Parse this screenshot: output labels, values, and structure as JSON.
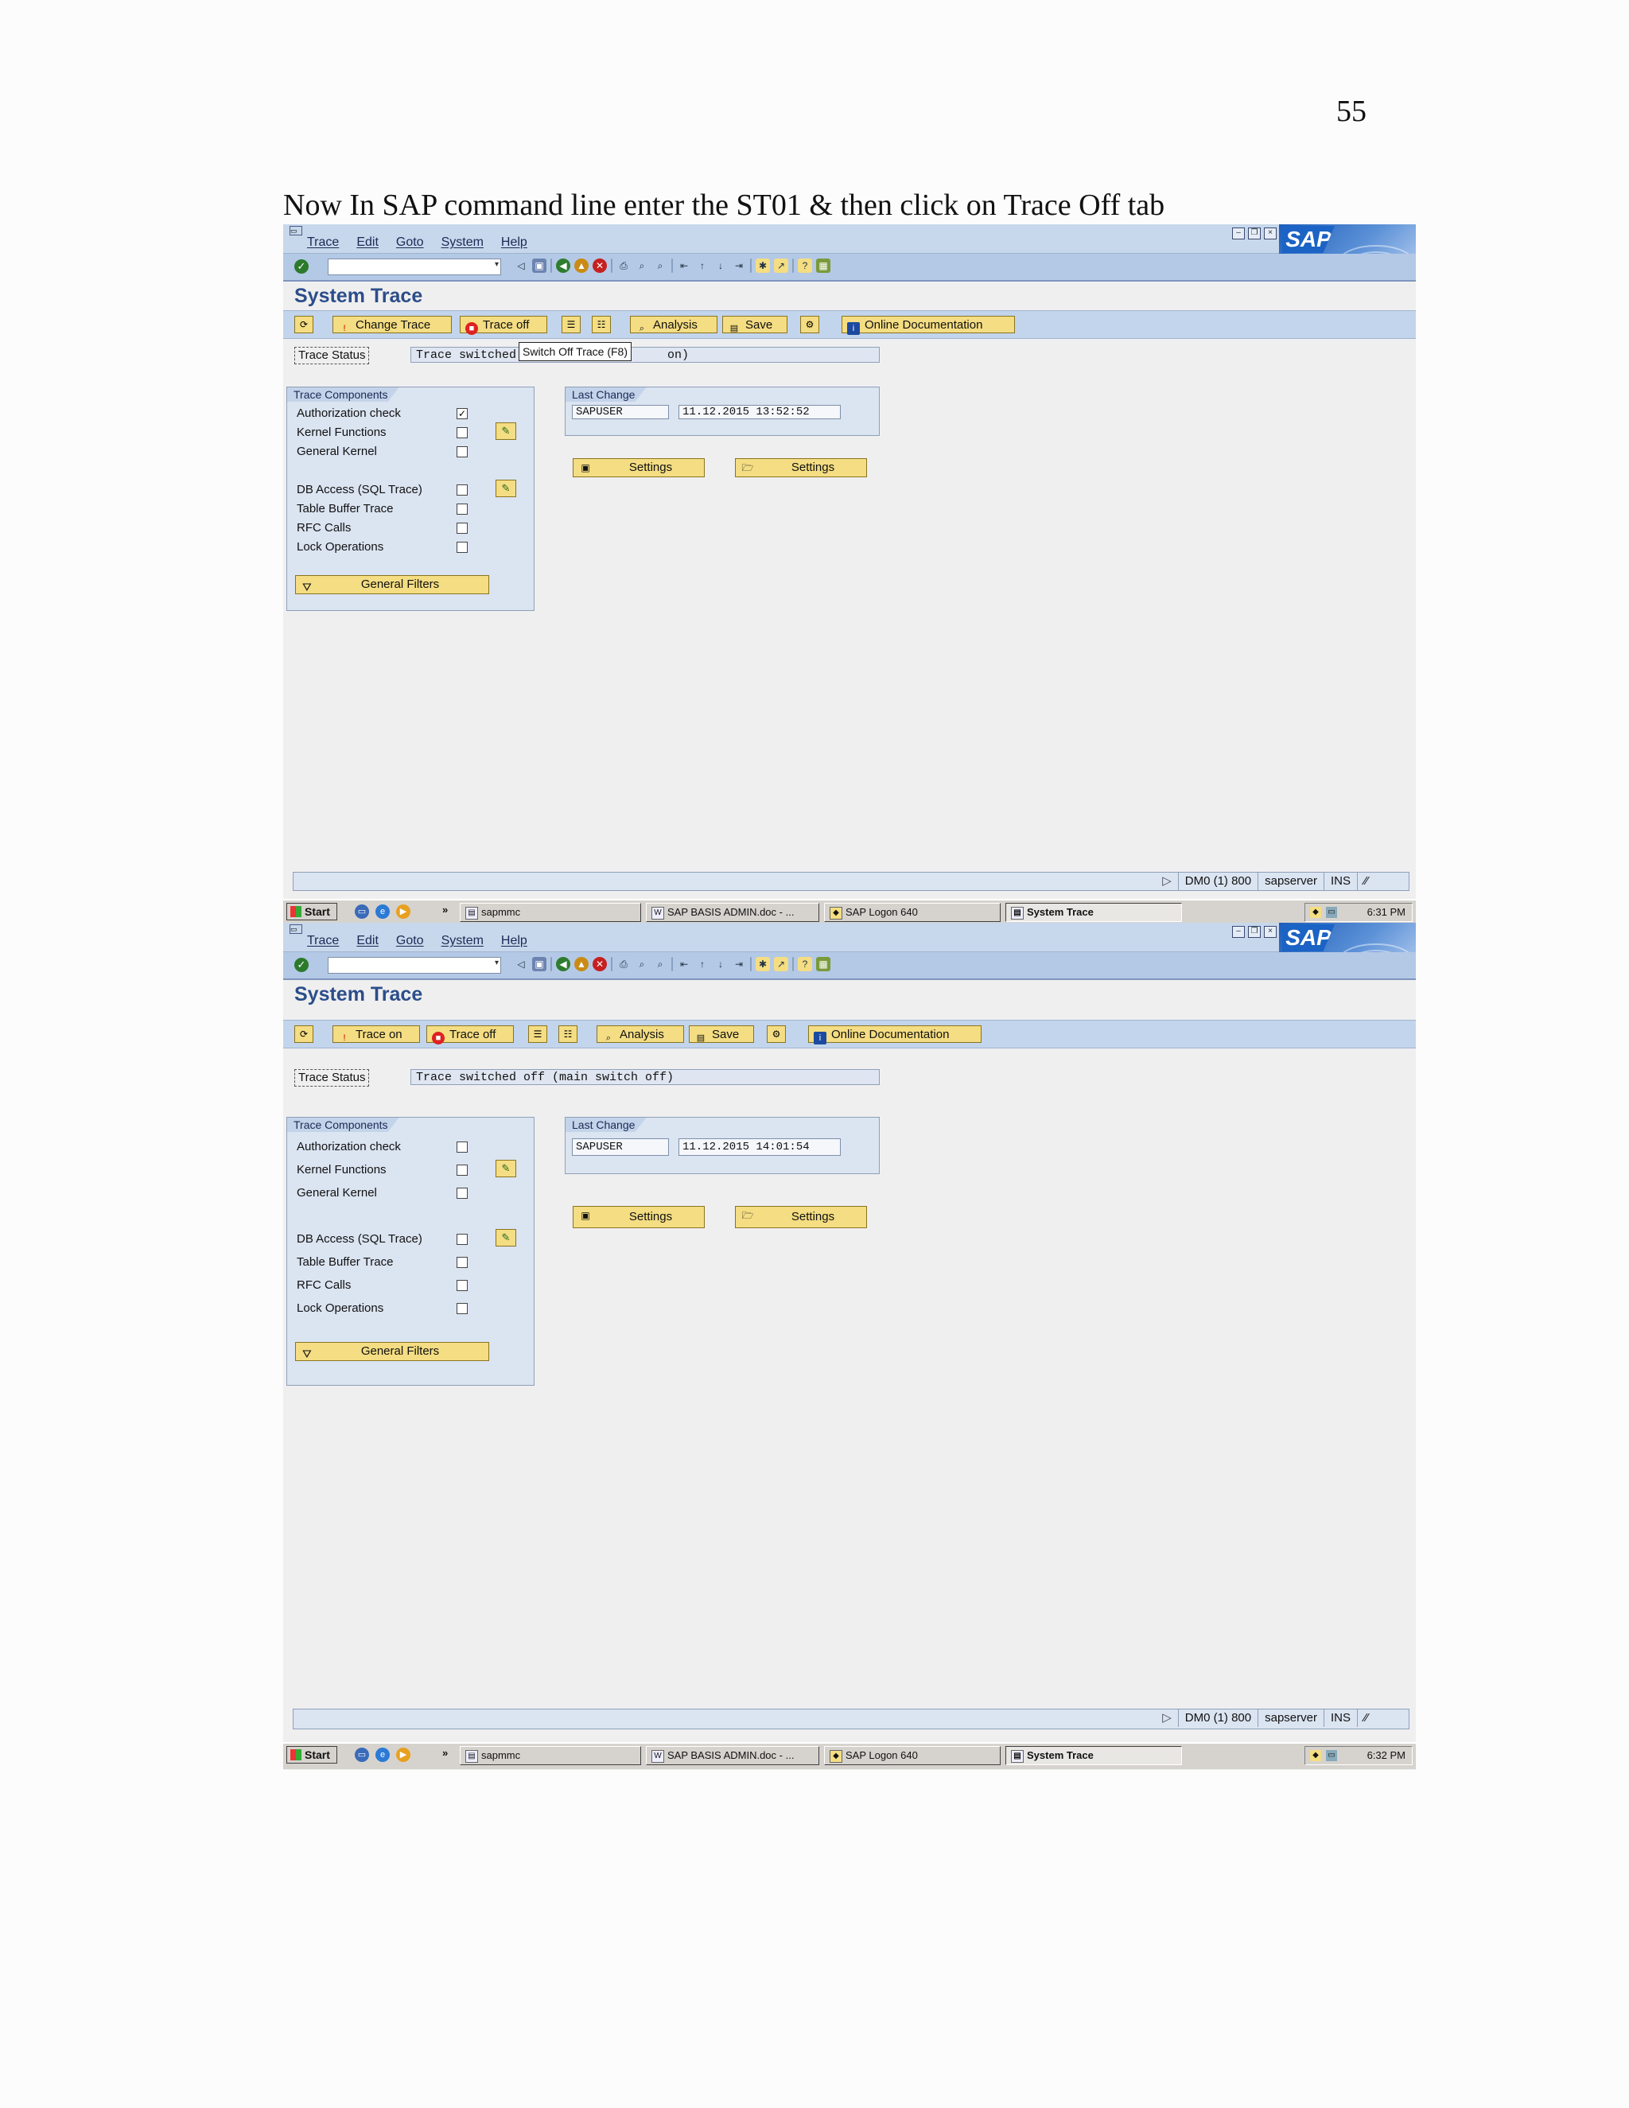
{
  "page": {
    "number": "55",
    "instruction": "Now In SAP command line enter the ST01 & then click on Trace Off tab"
  },
  "colors": {
    "sap_blue": "#2b4e8a",
    "button_yellow": "#f4dd82",
    "toolbar_blue": "#c3d5ec",
    "sap_logo": "#1b63c4"
  },
  "icons": {
    "enter": "check-circle-icon",
    "back": "back-arrow-icon",
    "exit": "exit-icon",
    "cancel": "cancel-icon",
    "filter": "funnel-icon",
    "details": "pencil-arrow-icon",
    "save_settings": "floppy-icon",
    "load_settings": "folder-open-icon"
  },
  "sapgui": {
    "menu": [
      "Trace",
      "Edit",
      "Goto",
      "System",
      "Help"
    ],
    "logo": "SAP",
    "title": "System Trace",
    "status_label": "Trace Status",
    "components_title": "Trace Components",
    "components": [
      "Authorization check",
      "Kernel Functions",
      "General Kernel",
      "DB Access (SQL Trace)",
      "Table Buffer Trace",
      "RFC Calls",
      "Lock Operations"
    ],
    "general_filters": "General Filters",
    "last_change_title": "Last Change",
    "settings_label": "Settings",
    "analysis": "Analysis",
    "save": "Save",
    "trace_off": "Trace off",
    "online_doc": "Online Documentation",
    "status_bar": {
      "system": "DM0 (1) 800",
      "server": "sapserver",
      "mode": "INS"
    }
  },
  "screen1": {
    "first_button": "Change Trace",
    "trace_status": "Trace switched",
    "trace_status_tail": "on)",
    "tooltip": "Switch Off Trace   (F8)",
    "checked": [
      true,
      false,
      false,
      false,
      false,
      false,
      false
    ],
    "last_change_user": "SAPUSER",
    "last_change_time": "11.12.2015 13:52:52",
    "clock": "6:31 PM"
  },
  "screen2": {
    "first_button": "Trace on",
    "trace_status": "Trace switched off (main switch off)",
    "checked": [
      false,
      false,
      false,
      false,
      false,
      false,
      false
    ],
    "last_change_user": "SAPUSER",
    "last_change_time": "11.12.2015 14:01:54",
    "clock": "6:32 PM"
  },
  "taskbar": {
    "start": "Start",
    "quick_more": "»",
    "tasks": [
      "sapmmc",
      "SAP BASIS ADMIN.doc - ...",
      "SAP Logon 640",
      "System Trace"
    ]
  }
}
